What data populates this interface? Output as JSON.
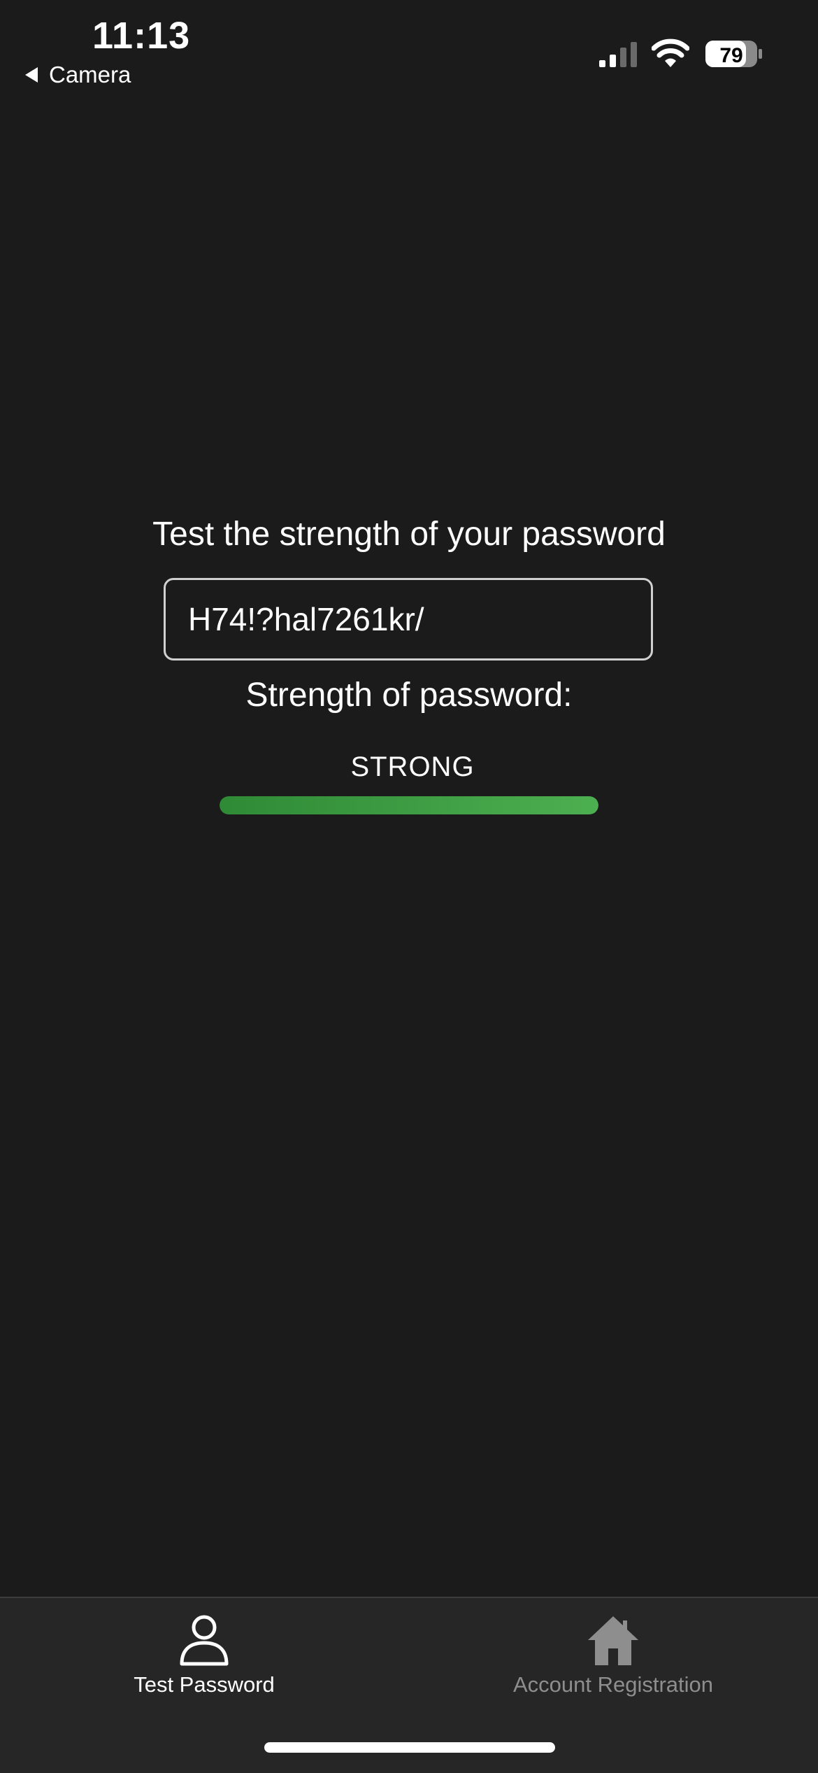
{
  "status_bar": {
    "time": "11:13",
    "back_label": "Camera",
    "battery_level": "79"
  },
  "main": {
    "heading": "Test the strength of your password",
    "password_value": "H74!?hal7261kr/",
    "strength_label": "Strength of password:",
    "strength_value": "STRONG",
    "strength_fraction": 1.0,
    "strength_color": "#4caf50"
  },
  "tab_bar": {
    "tabs": [
      {
        "label": "Test Password",
        "icon": "person-icon",
        "active": true
      },
      {
        "label": "Account Registration",
        "icon": "house-icon",
        "active": false
      }
    ]
  },
  "colors": {
    "background": "#1b1b1b",
    "tab_bar_background": "#262626",
    "active_tab": "#ffffff",
    "inactive_tab": "#8e8e8e"
  }
}
